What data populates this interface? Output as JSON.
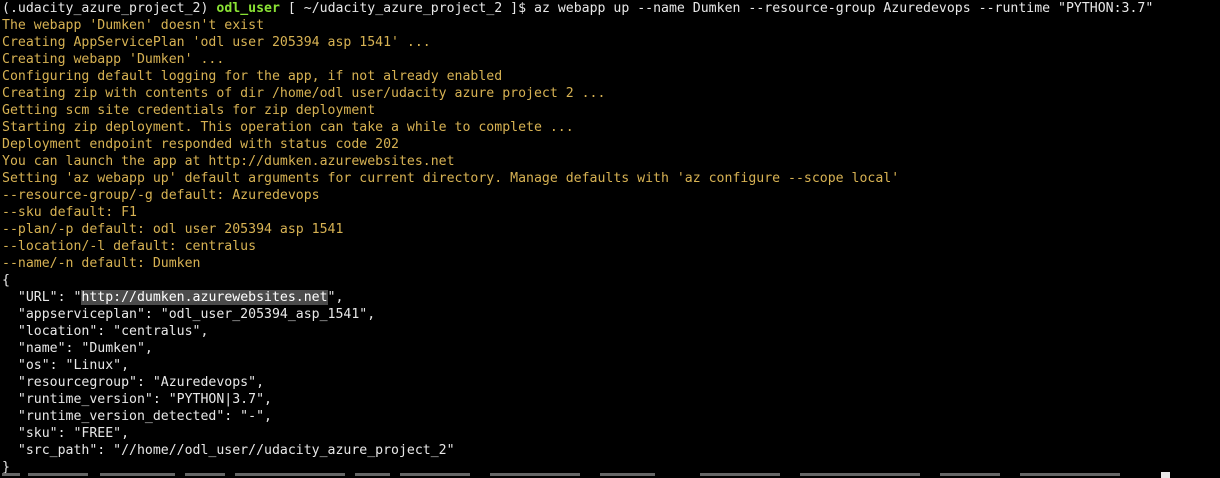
{
  "terminal": {
    "prompt": {
      "venv": "(.udacity_azure_project_2)",
      "user": "odl_user",
      "path": "[ ~/udacity_azure_project_2 ]$",
      "command": "az webapp up --name Dumken --resource-group Azuredevops --runtime \"PYTHON:3.7\""
    },
    "output_lines": [
      "The webapp 'Dumken' doesn't exist",
      "Creating AppServicePlan 'odl user 205394 asp 1541' ...",
      "Creating webapp 'Dumken' ...",
      "Configuring default logging for the app, if not already enabled",
      "Creating zip with contents of dir /home/odl user/udacity azure project 2 ...",
      "Getting scm site credentials for zip deployment",
      "Starting zip deployment. This operation can take a while to complete ...",
      "Deployment endpoint responded with status code 202",
      "You can launch the app at http://dumken.azurewebsites.net",
      "Setting 'az webapp up' default arguments for current directory. Manage defaults with 'az configure --scope local'",
      "--resource-group/-g default: Azuredevops",
      "--sku default: F1",
      "--plan/-p default: odl user 205394 asp 1541",
      "--location/-l default: centralus",
      "--name/-n default: Dumken"
    ],
    "json_open": "{",
    "url_line": {
      "prefix": "  \"URL\": \"",
      "value": "http://dumken.azurewebsites.net",
      "suffix": "\","
    },
    "json_lines": [
      "  \"appserviceplan\": \"odl_user_205394_asp_1541\",",
      "  \"location\": \"centralus\",",
      "  \"name\": \"Dumken\",",
      "  \"os\": \"Linux\",",
      "  \"resourcegroup\": \"Azuredevops\",",
      "  \"runtime_version\": \"PYTHON|3.7\",",
      "  \"runtime_version_detected\": \"-\",",
      "  \"sku\": \"FREE\",",
      "  \"src_path\": \"//home//odl_user//udacity_azure_project_2\""
    ],
    "json_close": "}"
  },
  "colors": {
    "background": "#000000",
    "text": "#e8e8e8",
    "output": "#d7b253",
    "user": "#8ae234",
    "selection": "#4b4b4b"
  }
}
